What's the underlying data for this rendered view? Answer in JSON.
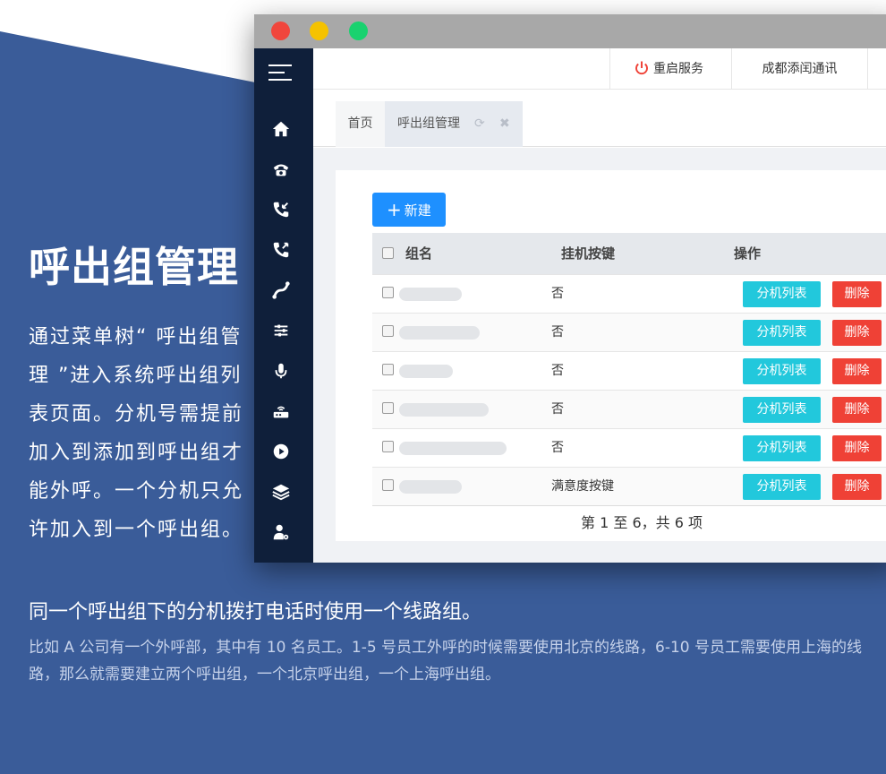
{
  "intro": {
    "headline": "呼出组管理",
    "description": "通过菜单树“ 呼出组管理 ”进入系统呼出组列表页面。分机号需提前加入到添加到呼出组才能外呼。一个分机只允许加入到一个呼出组。",
    "subheading": "同一个呼出组下的分机拨打电话时使用一个线路组。",
    "example": "比如 A 公司有一个外呼部，其中有 10 名员工。1-5 号员工外呼的时候需要使用北京的线路，6-10 号员工需要使用上海的线路，那么就需要建立两个呼出组，一个北京呼出组，一个上海呼出组。"
  },
  "window": {
    "traffic_lights": [
      "#f0463c",
      "#f5c200",
      "#19d26f"
    ],
    "topbar": {
      "restart_label": "重启服务",
      "company_label": "成都添闰通讯"
    },
    "tabs": {
      "home_label": "首页",
      "active_label": "呼出组管理"
    },
    "sidebar_icons": [
      "menu-toggle-icon",
      "home-icon",
      "telephone-icon",
      "incoming-call-icon",
      "outgoing-call-icon",
      "route-icon",
      "sliders-icon",
      "microphone-icon",
      "router-icon",
      "play-circle-icon",
      "layers-icon",
      "user-settings-icon"
    ],
    "toolbar": {
      "new_button_label": "新建"
    },
    "table": {
      "columns": [
        "组名",
        "挂机按键",
        "操作"
      ],
      "rows": [
        {
          "name": "",
          "hangup_key": "否",
          "ext_button": "分机列表",
          "delete_button": "删除"
        },
        {
          "name": "",
          "hangup_key": "否",
          "ext_button": "分机列表",
          "delete_button": "删除"
        },
        {
          "name": "",
          "hangup_key": "否",
          "ext_button": "分机列表",
          "delete_button": "删除"
        },
        {
          "name": "",
          "hangup_key": "否",
          "ext_button": "分机列表",
          "delete_button": "删除"
        },
        {
          "name": "",
          "hangup_key": "否",
          "ext_button": "分机列表",
          "delete_button": "删除"
        },
        {
          "name": "",
          "hangup_key": "满意度按键",
          "ext_button": "分机列表",
          "delete_button": "删除"
        }
      ]
    },
    "pagination": "第 1 至 6，共 6 项"
  },
  "colors": {
    "background": "#3a5c99",
    "sidebar": "#0f1f3a",
    "primary": "#1e90ff",
    "cyan": "#22c8dc",
    "danger": "#ef4136"
  }
}
